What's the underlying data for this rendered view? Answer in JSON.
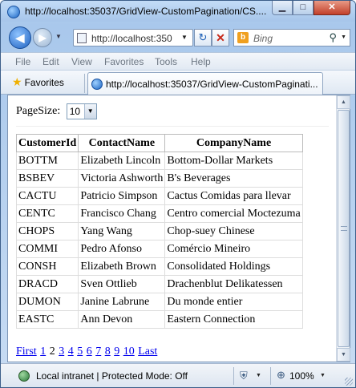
{
  "window": {
    "title": "http://localhost:35037/GridView-CustomPagination/CS....",
    "minimize": "▁",
    "maximize": "□",
    "close": "✕"
  },
  "nav": {
    "address": "http://localhost:350",
    "search_placeholder": "Bing",
    "back_icon": "back-arrow-icon",
    "forward_icon": "forward-arrow-icon"
  },
  "menu": [
    "File",
    "Edit",
    "View",
    "Favorites",
    "Tools",
    "Help"
  ],
  "favorites": {
    "label": "Favorites",
    "tab_title": "http://localhost:35037/GridView-CustomPaginati..."
  },
  "page": {
    "pagesize_label": "PageSize:",
    "pagesize_value": "10",
    "columns": [
      "CustomerId",
      "ContactName",
      "CompanyName"
    ],
    "rows": [
      [
        "BOTTM",
        "Elizabeth Lincoln",
        "Bottom-Dollar Markets"
      ],
      [
        "BSBEV",
        "Victoria Ashworth",
        "B's Beverages"
      ],
      [
        "CACTU",
        "Patricio Simpson",
        "Cactus Comidas para llevar"
      ],
      [
        "CENTC",
        "Francisco Chang",
        "Centro comercial Moctezuma"
      ],
      [
        "CHOPS",
        "Yang Wang",
        "Chop-suey Chinese"
      ],
      [
        "COMMI",
        "Pedro Afonso",
        "Comércio Mineiro"
      ],
      [
        "CONSH",
        "Elizabeth Brown",
        "Consolidated Holdings"
      ],
      [
        "DRACD",
        "Sven Ottlieb",
        "Drachenblut Delikatessen"
      ],
      [
        "DUMON",
        "Janine Labrune",
        "Du monde entier"
      ],
      [
        "EASTC",
        "Ann Devon",
        "Eastern Connection"
      ]
    ],
    "pager": {
      "first": "First",
      "pages": [
        "1",
        "2",
        "3",
        "4",
        "5",
        "6",
        "7",
        "8",
        "9",
        "10"
      ],
      "current": "2",
      "last": "Last"
    }
  },
  "status": {
    "zone": "Local intranet | Protected Mode: Off",
    "zoom": "100%"
  }
}
